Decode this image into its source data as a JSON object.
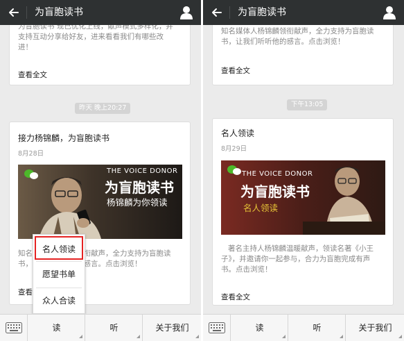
{
  "left": {
    "header": {
      "title": "为盲胞读书"
    },
    "prev_card": {
      "line1": "为盲胞读书 现已优化上线，献声模式多样化，并",
      "line2": "支持互动分享给好友，进来看看我们有哪些改",
      "line3": "进！",
      "read_all": "查看全文"
    },
    "timestamp": "昨天 晚上20:27",
    "card": {
      "title": "接力杨锦麟，为盲胞读书",
      "date": "8月28日",
      "banner": {
        "brand": "THE VOICE DONOR",
        "headline": "为盲胞读书",
        "sub": "杨锦麟为你领读"
      },
      "desc_line1": "知名媒体人杨锦麟领衔献声，全力支持为盲胞读",
      "desc_line2": "书，让我们听听他的感言。点击浏览！",
      "read_all": "查看全文"
    },
    "popup": {
      "items": [
        "名人领读",
        "愿望书单",
        "众人合读"
      ]
    },
    "bottom_menu": {
      "items": [
        "读",
        "听",
        "关于我们"
      ]
    }
  },
  "right": {
    "header": {
      "title": "为盲胞读书"
    },
    "prev_card": {
      "line1": "知名媒体人杨锦麟领衔献声，全力支持为盲胞读",
      "line2": "书，让我们听听他的感言。点击浏览！",
      "read_all": "查看全文"
    },
    "timestamp": "下午13:05",
    "card": {
      "title": "名人领读",
      "date": "8月29日",
      "banner": {
        "brand": "THE VOICE DONOR",
        "headline": "为盲胞读书",
        "sub": "名人领读"
      },
      "desc_line1": "著名主持人杨锦麟温暖献声，领读名著《小王",
      "desc_line2": "子》，并邀请你一起参与，合力为盲胞完成有声",
      "desc_line3": "书。点击浏览！",
      "read_all": "查看全文"
    },
    "bottom_menu": {
      "items": [
        "读",
        "听",
        "关于我们"
      ]
    }
  },
  "colors": {
    "header_bg": "#2e3132",
    "highlight_border": "#e52222",
    "banner_dark": "#2b2622",
    "banner_red": "#8a2e24"
  },
  "icons": {
    "back": "back-arrow-icon",
    "profile": "person-icon",
    "keyboard": "keyboard-icon",
    "wechat": "wechat-logo-icon"
  }
}
